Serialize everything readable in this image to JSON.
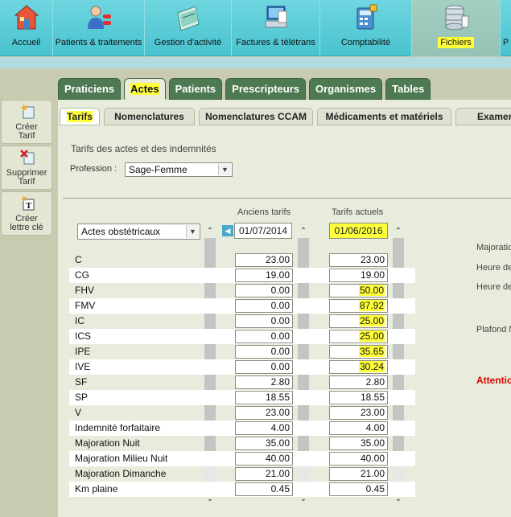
{
  "toolbar": {
    "items": [
      {
        "label": "Accueil",
        "icon": "home-icon"
      },
      {
        "label": "Patients & traitements",
        "icon": "patients-icon"
      },
      {
        "label": "Gestion d'activité",
        "icon": "activity-folder-icon"
      },
      {
        "label": "Factures & télétrans",
        "icon": "invoice-computer-icon"
      },
      {
        "label": "Comptabilité",
        "icon": "calculator-icon"
      },
      {
        "label": "Fichiers",
        "icon": "database-icon"
      },
      {
        "label": "P",
        "icon": "partial-icon"
      }
    ],
    "active": "Fichiers"
  },
  "file_tabs": [
    "Praticiens",
    "Actes",
    "Patients",
    "Prescripteurs",
    "Organismes",
    "Tables"
  ],
  "file_tabs_active": "Actes",
  "side_buttons": [
    {
      "label": "Créer Tarif",
      "icon": "new-tariff-icon"
    },
    {
      "label": "Supprimer Tarif",
      "icon": "delete-tariff-icon"
    },
    {
      "label": "Créer lettre clé",
      "icon": "new-key-letter-icon"
    }
  ],
  "sub_tabs": [
    "Tarifs",
    "Nomenclatures",
    "Nomenclatures CCAM",
    "Médicaments et matériels",
    "Examens"
  ],
  "sub_tabs_active": "Tarifs",
  "section_title": "Tarifs des actes et des indemnités",
  "profession": {
    "label": "Profession :",
    "value": "Sage-Femme"
  },
  "category": {
    "value": "Actes obstétricaux"
  },
  "old_tariffs": {
    "header": "Anciens tarifs",
    "date": "01/07/2014"
  },
  "current_tariffs": {
    "header": "Tarifs actuels",
    "date": "01/06/2016"
  },
  "rows": [
    {
      "name": "C",
      "old": "23.00",
      "new": "23.00",
      "highlight": false
    },
    {
      "name": "CG",
      "old": "19.00",
      "new": "19.00",
      "highlight": false
    },
    {
      "name": "FHV",
      "old": "0.00",
      "new": "50.00",
      "highlight": true
    },
    {
      "name": "FMV",
      "old": "0.00",
      "new": "87.92",
      "highlight": true
    },
    {
      "name": "IC",
      "old": "0.00",
      "new": "25.00",
      "highlight": true
    },
    {
      "name": "ICS",
      "old": "0.00",
      "new": "25.00",
      "highlight": true
    },
    {
      "name": "IPE",
      "old": "0.00",
      "new": "35.65",
      "highlight": true
    },
    {
      "name": "IVE",
      "old": "0.00",
      "new": "30.24",
      "highlight": true
    },
    {
      "name": "SF",
      "old": "2.80",
      "new": "2.80",
      "highlight": false
    },
    {
      "name": "SP",
      "old": "18.55",
      "new": "18.55",
      "highlight": false
    },
    {
      "name": "V",
      "old": "23.00",
      "new": "23.00",
      "highlight": false
    },
    {
      "name": "Indemnité forfaitaire",
      "old": "4.00",
      "new": "4.00",
      "highlight": false
    },
    {
      "name": "Majoration Nuit",
      "old": "35.00",
      "new": "35.00",
      "highlight": false
    },
    {
      "name": "Majoration Milieu Nuit",
      "old": "40.00",
      "new": "40.00",
      "highlight": false
    },
    {
      "name": "Majoration Dimanche",
      "old": "21.00",
      "new": "21.00",
      "highlight": false
    },
    {
      "name": "Km plaine",
      "old": "0.45",
      "new": "0.45",
      "highlight": false
    }
  ],
  "right_labels": [
    {
      "text": "Majoratio",
      "red": false
    },
    {
      "text": "Heure de",
      "red": false
    },
    {
      "text": "Heure de",
      "red": false
    },
    {
      "text": "Plafond M",
      "red": false
    },
    {
      "text": "Attentic",
      "red": true
    }
  ],
  "colors": {
    "toolbar": "#55c8d3",
    "highlight": "#ffff3a",
    "tab_dark": "#4d7a52",
    "panel": "#e8ecdc",
    "warning": "#dd0000"
  }
}
